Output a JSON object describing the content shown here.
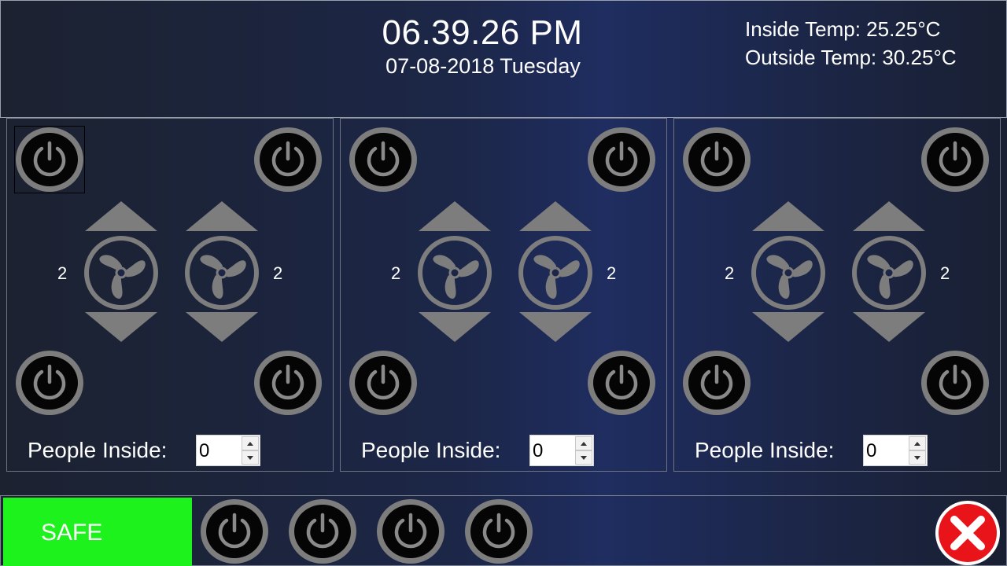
{
  "header": {
    "time": "06.39.26 PM",
    "date": "07-08-2018 Tuesday",
    "inside_temp": "Inside Temp: 25.25°C",
    "outside_temp": "Outside Temp: 30.25°C"
  },
  "rooms": [
    {
      "fan_left_speed": "2",
      "fan_right_speed": "2",
      "people_label": "People Inside:",
      "people_value": "0"
    },
    {
      "fan_left_speed": "2",
      "fan_right_speed": "2",
      "people_label": "People Inside:",
      "people_value": "0"
    },
    {
      "fan_left_speed": "2",
      "fan_right_speed": "2",
      "people_label": "People Inside:",
      "people_value": "0"
    }
  ],
  "footer": {
    "status_label": "SAFE"
  },
  "colors": {
    "safe_status": "#1df21d",
    "close_button": "#e8141a",
    "control_gray": "#7d7d7d"
  },
  "icons": {
    "power": "power-icon",
    "fan": "fan-icon",
    "increase": "triangle-up-icon",
    "decrease": "triangle-down-icon",
    "close": "close-x-icon"
  }
}
